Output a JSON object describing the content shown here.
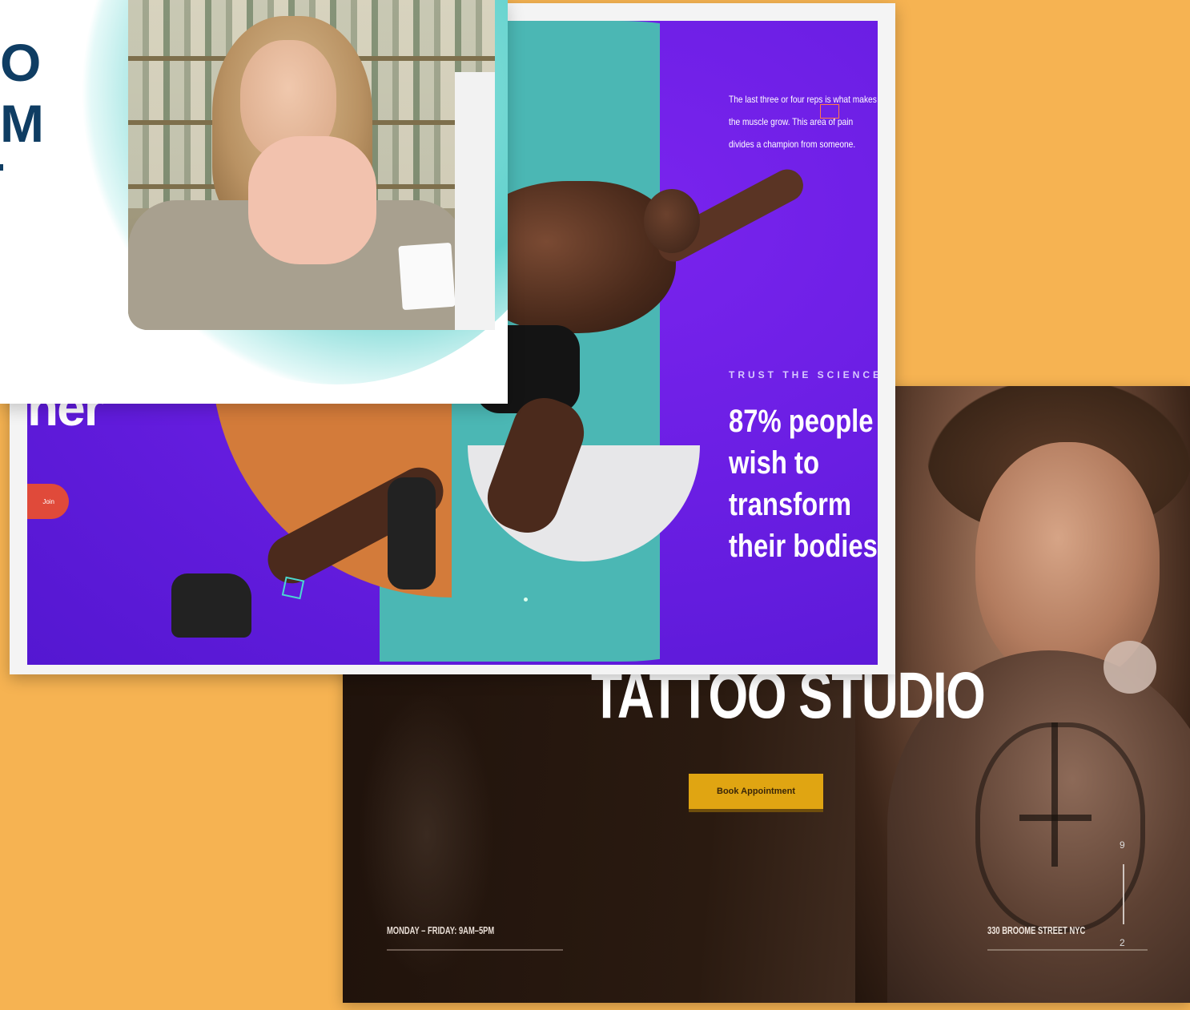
{
  "tattoo": {
    "title": "TATTOO STUDIO",
    "book_button": "Book Appointment",
    "hours": "MONDAY – FRIDAY: 9AM–5PM",
    "address": "330 BROOME STREET NYC",
    "slide_current": "9",
    "slide_total": "2"
  },
  "fitness": {
    "paragraph": "The last three or four reps is what makes the muscle grow. This area of pain divides a champion from someone.",
    "kicker": "TRUST THE SCIENCE",
    "stat_line1": "87% people",
    "stat_line2": "wish to transform",
    "stat_line3": "their bodies",
    "left_heading": "ner",
    "left_button": "Join"
  },
  "pharmacy": {
    "logo_line1": "O",
    "logo_line2": "M"
  },
  "colors": {
    "background": "#f6b352",
    "fitness_purple": "#6a1ee3",
    "teal": "#4bb7b4",
    "orange": "#d37b3a",
    "tattoo_button": "#e0a512",
    "pharmacy_navy": "#0f3d63"
  }
}
